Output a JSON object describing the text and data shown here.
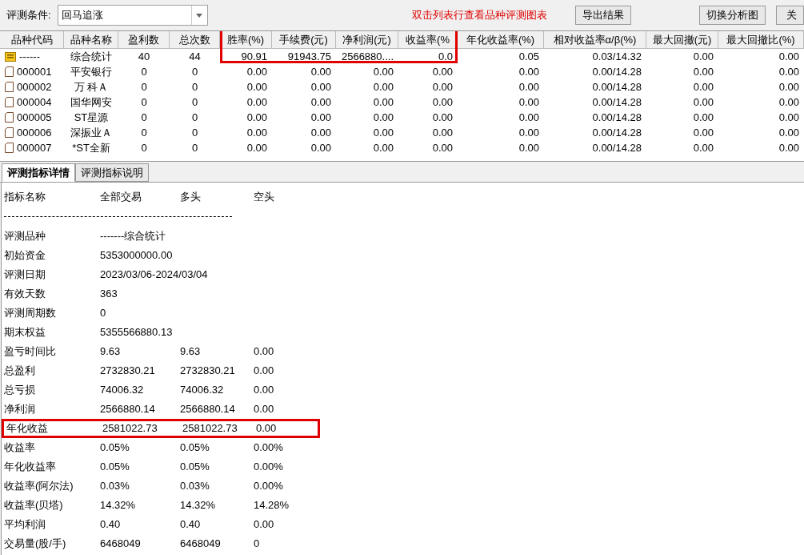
{
  "toolbar": {
    "condition_label": "评测条件:",
    "condition_value": "回马追涨",
    "hint": "双击列表行查看品种评测图表",
    "buttons": [
      "导出结果",
      "切换分析图",
      "关"
    ]
  },
  "table": {
    "columns": [
      {
        "label": "品种代码",
        "highlighted": false
      },
      {
        "label": "品种名称",
        "highlighted": false
      },
      {
        "label": "盈利数",
        "highlighted": false
      },
      {
        "label": "总次数",
        "highlighted": false
      },
      {
        "label": "胜率(%)",
        "highlighted": true
      },
      {
        "label": "手续费(元)",
        "highlighted": true
      },
      {
        "label": "净利润(元)",
        "highlighted": true
      },
      {
        "label": "收益率(%",
        "highlighted": true
      },
      {
        "label": "年化收益率(%)",
        "highlighted": false
      },
      {
        "label": "相对收益率α/β(%)",
        "highlighted": false
      },
      {
        "label": "最大回撤(元)",
        "highlighted": false
      },
      {
        "label": "最大回撤比(%)",
        "highlighted": false
      }
    ],
    "rows": [
      {
        "kind": "summary",
        "cells": [
          "------",
          "综合统计",
          "40",
          "44",
          "90.91",
          "91943.75",
          "2566880....",
          "0.0",
          "0.05",
          "0.03/14.32",
          "0.00",
          "0.00"
        ]
      },
      {
        "kind": "stock",
        "cells": [
          "000001",
          "平安银行",
          "0",
          "0",
          "0.00",
          "0.00",
          "0.00",
          "0.00",
          "0.00",
          "0.00/14.28",
          "0.00",
          "0.00"
        ]
      },
      {
        "kind": "stock",
        "cells": [
          "000002",
          "万 科Ａ",
          "0",
          "0",
          "0.00",
          "0.00",
          "0.00",
          "0.00",
          "0.00",
          "0.00/14.28",
          "0.00",
          "0.00"
        ]
      },
      {
        "kind": "stock",
        "cells": [
          "000004",
          "国华网安",
          "0",
          "0",
          "0.00",
          "0.00",
          "0.00",
          "0.00",
          "0.00",
          "0.00/14.28",
          "0.00",
          "0.00"
        ]
      },
      {
        "kind": "stock",
        "cells": [
          "000005",
          "ST星源",
          "0",
          "0",
          "0.00",
          "0.00",
          "0.00",
          "0.00",
          "0.00",
          "0.00/14.28",
          "0.00",
          "0.00"
        ]
      },
      {
        "kind": "stock",
        "cells": [
          "000006",
          "深振业Ａ",
          "0",
          "0",
          "0.00",
          "0.00",
          "0.00",
          "0.00",
          "0.00",
          "0.00/14.28",
          "0.00",
          "0.00"
        ]
      },
      {
        "kind": "stock",
        "cells": [
          "000007",
          "*ST全新",
          "0",
          "0",
          "0.00",
          "0.00",
          "0.00",
          "0.00",
          "0.00",
          "0.00/14.28",
          "0.00",
          "0.00"
        ]
      }
    ]
  },
  "tabs": [
    {
      "label": "评测指标详情",
      "selected": true
    },
    {
      "label": "评测指标说明",
      "selected": false
    }
  ],
  "details": {
    "header": [
      "指标名称",
      "全部交易",
      "多头",
      "空头"
    ],
    "rows": [
      {
        "cells": [
          "评测品种",
          "-------综合统计"
        ],
        "highlighted": false
      },
      {
        "cells": [
          "初始资金",
          "5353000000.00"
        ],
        "highlighted": false
      },
      {
        "cells": [
          "评测日期",
          "2023/03/06-2024/03/04"
        ],
        "highlighted": false
      },
      {
        "cells": [
          "有效天数",
          "363"
        ],
        "highlighted": false
      },
      {
        "cells": [
          "评测周期数",
          "0"
        ],
        "highlighted": false
      },
      {
        "cells": [
          "期末权益",
          "5355566880.13"
        ],
        "highlighted": false
      },
      {
        "cells": [
          "盈亏时间比",
          "9.63",
          "9.63",
          "0.00"
        ],
        "highlighted": false
      },
      {
        "cells": [
          "总盈利",
          "2732830.21",
          "2732830.21",
          "0.00"
        ],
        "highlighted": false
      },
      {
        "cells": [
          "总亏损",
          "74006.32",
          "74006.32",
          "0.00"
        ],
        "highlighted": false
      },
      {
        "cells": [
          "净利润",
          "2566880.14",
          "2566880.14",
          "0.00"
        ],
        "highlighted": false
      },
      {
        "cells": [
          "年化收益",
          "2581022.73",
          "2581022.73",
          "0.00"
        ],
        "highlighted": true
      },
      {
        "cells": [
          "收益率",
          "0.05%",
          "0.05%",
          "0.00%"
        ],
        "highlighted": false
      },
      {
        "cells": [
          "年化收益率",
          "0.05%",
          "0.05%",
          "0.00%"
        ],
        "highlighted": false
      },
      {
        "cells": [
          "收益率(阿尔法)",
          "0.03%",
          "0.03%",
          "0.00%"
        ],
        "highlighted": false
      },
      {
        "cells": [
          "收益率(贝塔)",
          "14.32%",
          "14.32%",
          "14.28%"
        ],
        "highlighted": false
      },
      {
        "cells": [
          "平均利润",
          "0.40",
          "0.40",
          "0.00"
        ],
        "highlighted": false
      },
      {
        "cells": [
          "交易量(股/手)",
          "6468049",
          "6468049",
          "0"
        ],
        "highlighted": false
      }
    ]
  }
}
